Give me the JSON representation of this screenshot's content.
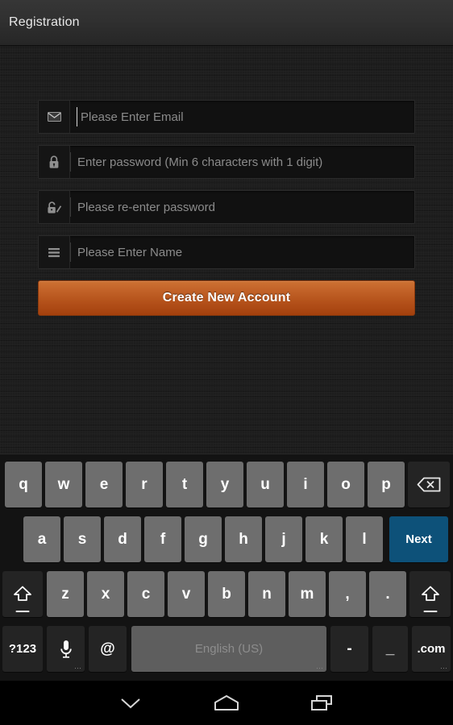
{
  "titlebar": {
    "title": "Registration"
  },
  "form": {
    "fields": [
      {
        "name": "email",
        "icon": "envelope-icon",
        "placeholder": "Please Enter Email",
        "focused": true
      },
      {
        "name": "password",
        "icon": "lock-icon",
        "placeholder": "Enter password (Min 6 characters with 1 digit)",
        "focused": false
      },
      {
        "name": "repassword",
        "icon": "lock-pen-icon",
        "placeholder": "Please re-enter password",
        "focused": false
      },
      {
        "name": "fullname",
        "icon": "list-icon",
        "placeholder": "Please Enter Name",
        "focused": false
      }
    ],
    "submit_label": "Create New Account",
    "submit_color": "#b4511a"
  },
  "keyboard": {
    "language_label": "English (US)",
    "rows": [
      {
        "keys": [
          {
            "label": "q",
            "style": "light"
          },
          {
            "label": "w",
            "style": "light"
          },
          {
            "label": "e",
            "style": "light"
          },
          {
            "label": "r",
            "style": "light"
          },
          {
            "label": "t",
            "style": "light"
          },
          {
            "label": "y",
            "style": "light"
          },
          {
            "label": "u",
            "style": "light"
          },
          {
            "label": "i",
            "style": "light"
          },
          {
            "label": "o",
            "style": "light"
          },
          {
            "label": "p",
            "style": "light"
          },
          {
            "label": "",
            "style": "dark",
            "icon": "backspace-icon",
            "name": "backspace-key"
          }
        ]
      },
      {
        "keys": [
          {
            "label": "a",
            "style": "light"
          },
          {
            "label": "s",
            "style": "light"
          },
          {
            "label": "d",
            "style": "light"
          },
          {
            "label": "f",
            "style": "light"
          },
          {
            "label": "g",
            "style": "light"
          },
          {
            "label": "h",
            "style": "light"
          },
          {
            "label": "j",
            "style": "light"
          },
          {
            "label": "k",
            "style": "light"
          },
          {
            "label": "l",
            "style": "light"
          },
          {
            "label": "Next",
            "style": "action",
            "name": "next-key"
          }
        ]
      },
      {
        "keys": [
          {
            "label": "",
            "style": "dark",
            "icon": "shift-icon",
            "name": "shift-left-key"
          },
          {
            "label": "z",
            "style": "light"
          },
          {
            "label": "x",
            "style": "light"
          },
          {
            "label": "c",
            "style": "light"
          },
          {
            "label": "v",
            "style": "light"
          },
          {
            "label": "b",
            "style": "light"
          },
          {
            "label": "n",
            "style": "light"
          },
          {
            "label": "m",
            "style": "light"
          },
          {
            "label": ",",
            "style": "light"
          },
          {
            "label": ".",
            "style": "light"
          },
          {
            "label": "",
            "style": "dark",
            "icon": "shift-icon",
            "name": "shift-right-key"
          }
        ]
      },
      {
        "keys": [
          {
            "label": "?123",
            "style": "dark",
            "name": "symbols-key"
          },
          {
            "label": "",
            "style": "dark",
            "icon": "microphone-icon",
            "name": "voice-input-key"
          },
          {
            "label": "@",
            "style": "dark",
            "name": "at-key"
          },
          {
            "label": "English (US)",
            "style": "space",
            "name": "space-key"
          },
          {
            "label": "-",
            "style": "dark",
            "name": "hyphen-key"
          },
          {
            "label": "_",
            "style": "dark",
            "name": "underscore-key"
          },
          {
            "label": ".com",
            "style": "dark",
            "name": "dotcom-key"
          }
        ]
      }
    ]
  },
  "navbar": {
    "buttons": [
      {
        "name": "hide-keyboard-button",
        "icon": "chevron-down-icon"
      },
      {
        "name": "home-button",
        "icon": "home-icon"
      },
      {
        "name": "recents-button",
        "icon": "recents-icon"
      }
    ]
  }
}
